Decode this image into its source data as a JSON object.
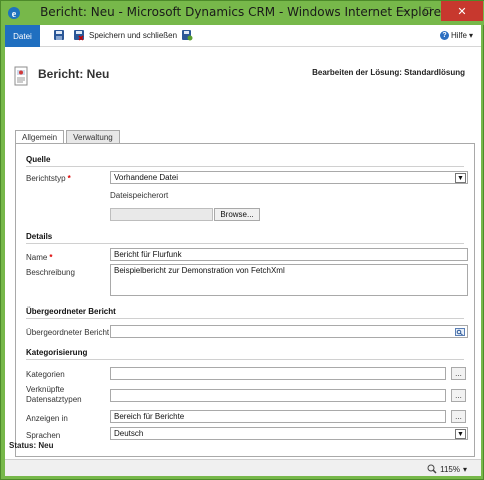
{
  "window": {
    "title": "Bericht: Neu - Microsoft Dynamics CRM - Windows Internet Explorer"
  },
  "ribbon": {
    "file_tab": "Datei",
    "save_close_label": "Speichern und schließen",
    "help_label": "Hilfe"
  },
  "header": {
    "form_title": "Bericht: Neu",
    "solution_label": "Bearbeiten der Lösung: Standardlösung"
  },
  "tabs": [
    {
      "label": "Allgemein",
      "active": true
    },
    {
      "label": "Verwaltung",
      "active": false
    }
  ],
  "sections": {
    "quelle": {
      "title": "Quelle",
      "report_type_label": "Berichtstyp",
      "report_type_value": "Vorhandene Datei",
      "file_location_label": "Dateispeicherort",
      "browse_label": "Browse..."
    },
    "details": {
      "title": "Details",
      "name_label": "Name",
      "name_value": "Bericht für Flurfunk",
      "description_label": "Beschreibung",
      "description_value": "Beispielbericht zur Demonstration von FetchXml"
    },
    "parent": {
      "title": "Übergeordneter Bericht",
      "parent_label": "Übergeordneter Bericht",
      "parent_value": ""
    },
    "categorization": {
      "title": "Kategorisierung",
      "categories_label": "Kategorien",
      "categories_value": "",
      "related_label_1": "Verknüpfte",
      "related_label_2": "Datensatztypen",
      "related_value": "",
      "display_in_label": "Anzeigen in",
      "display_in_value": "Bereich für Berichte",
      "languages_label": "Sprachen",
      "languages_value": "Deutsch",
      "ellipsis": "..."
    }
  },
  "status": {
    "label": "Status:",
    "value": "Neu"
  },
  "ie_status": {
    "zoom": "115%"
  },
  "icons": [
    "ie-icon",
    "save-icon",
    "save-close-icon",
    "publish-icon",
    "help-icon",
    "report-icon",
    "lookup-icon",
    "zoom-icon"
  ],
  "colors": {
    "title_bar": "#77b84a",
    "file_tab": "#1f6fc0",
    "close_button": "#c7382e",
    "required": "#dd0000"
  }
}
